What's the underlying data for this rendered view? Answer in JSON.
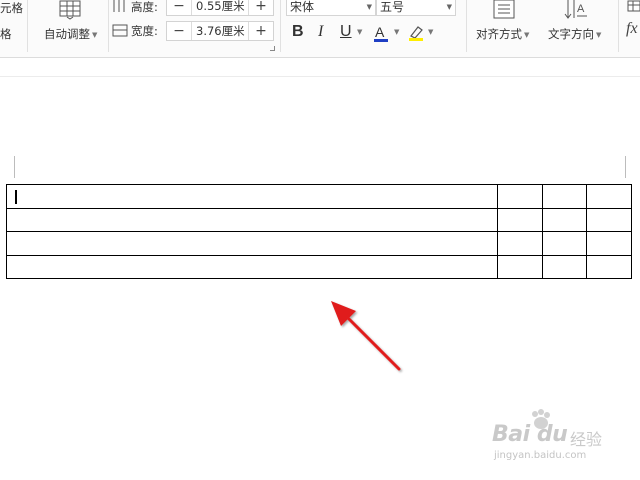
{
  "ribbon": {
    "cell_label_top": "元格",
    "cell_label_bottom": "格",
    "auto_adjust_label": "自动调整",
    "height_label": "高度:",
    "height_value": "0.55厘米",
    "width_label": "宽度:",
    "width_value": "3.76厘米",
    "minus": "−",
    "plus": "+",
    "font_name": "宋体",
    "font_size": "五号",
    "bold": "B",
    "italic": "I",
    "underline": "U",
    "font_color": "A",
    "align_label": "对齐方式",
    "text_direction_label": "文字方向",
    "formula": "fx"
  },
  "document": {
    "table": {
      "rows": 4,
      "columns": 4
    }
  },
  "colors": {
    "font_color_bar": "#1f3fc4",
    "highlight_bar": "#ffee00",
    "arrow": "#e01f1f"
  },
  "watermark": {
    "logo": "Bai du",
    "brand_cn": "经验",
    "url": "jingyan.baidu.com"
  }
}
